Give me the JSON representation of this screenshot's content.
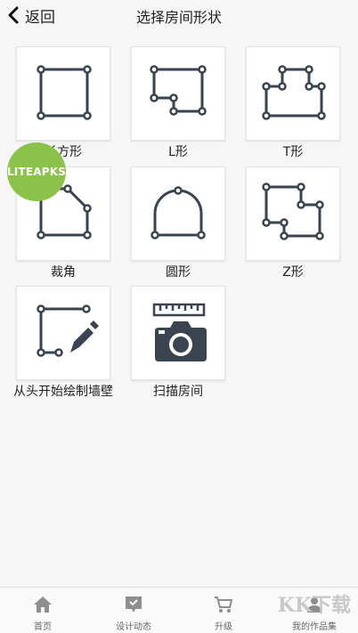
{
  "header": {
    "back_label": "返回",
    "title": "选择房间形状"
  },
  "shapes": [
    {
      "label": "长方形",
      "icon": "rectangle-shape-icon"
    },
    {
      "label": "L形",
      "icon": "l-shape-icon"
    },
    {
      "label": "T形",
      "icon": "t-shape-icon"
    },
    {
      "label": "裁角",
      "icon": "cut-corner-shape-icon"
    },
    {
      "label": "圆形",
      "icon": "arch-shape-icon"
    },
    {
      "label": "Z形",
      "icon": "z-shape-icon"
    },
    {
      "label": "从头开始绘制墙壁",
      "icon": "draw-walls-icon"
    },
    {
      "label": "扫描房间",
      "icon": "scan-room-camera-icon"
    }
  ],
  "watermark": "LITEAPKS",
  "tabbar": {
    "tabs": [
      {
        "label": "首页",
        "icon": "home-icon"
      },
      {
        "label": "设计动态",
        "icon": "chat-bubble-icon"
      },
      {
        "label": "升级",
        "icon": "cart-icon"
      },
      {
        "label": "我的作品集",
        "icon": "user-icon"
      }
    ]
  },
  "corner_watermark": "KK下载",
  "colors": {
    "icon": "#3a4350",
    "background": "#f6f6f6",
    "tile": "#ffffff",
    "watermark": "#8bc34a"
  }
}
